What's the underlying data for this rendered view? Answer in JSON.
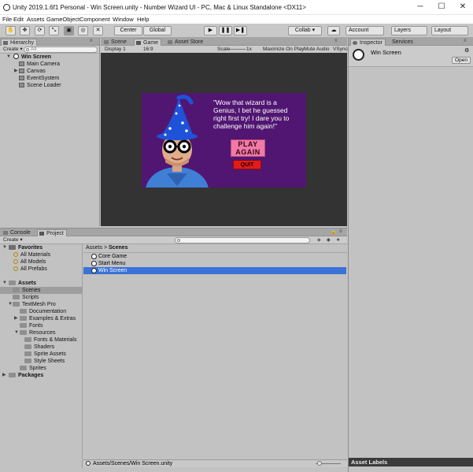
{
  "window": {
    "title": "Unity 2019.1.6f1 Personal - Win Screen.unity - Number Wizard UI - PC, Mac & Linux Standalone <DX11>",
    "minimize": "─",
    "maximize": "☐",
    "close": "✕"
  },
  "menu": [
    "File",
    "Edit",
    "Assets",
    "GameObject",
    "Component",
    "Window",
    "Help"
  ],
  "toolbar": {
    "tools": [
      "✋",
      "✥",
      "⟳",
      "⤡",
      "▣",
      "◎",
      "✕"
    ],
    "pivot_label": "Center",
    "space_label": "Global",
    "play": "▶",
    "pause": "❚❚",
    "step": "▶❚",
    "collab_label": "Collab ▾",
    "cloud": "☁",
    "account_label": "Account",
    "layers_label": "Layers",
    "layout_label": "Layout"
  },
  "hierarchy": {
    "tab_label": "Hierarchy",
    "create_label": "Create ▾",
    "search_placeholder": "All",
    "scene_name": "Win Screen",
    "items": [
      "Main Camera",
      "Canvas",
      "EventSystem",
      "Scene Loader"
    ]
  },
  "scene_tabs": {
    "scene": "Scene",
    "game": "Game",
    "asset_store": "Asset Store"
  },
  "game_bar": {
    "display": "Display 1",
    "aspect": "16:9",
    "scale_label": "Scale",
    "scale_value": "1x",
    "maximize": "Maximize On Play",
    "mute": "Mute Audio",
    "vsync": "VSync"
  },
  "game_view": {
    "dialog": "\"Wow that wizard is a Genius, I bet he guessed right first try! I dare you to challenge him again!\"",
    "play_button": "PLAY AGAIN",
    "quit_button": "QUIT"
  },
  "inspector": {
    "tab_label": "Inspector",
    "services_label": "Services",
    "object_name": "Win Screen",
    "open_label": "Open",
    "gear": "⚙"
  },
  "bottom_tabs": {
    "console": "Console",
    "project": "Project"
  },
  "project": {
    "create_label": "Create ▾",
    "search_placeholder": "",
    "favorites": {
      "label": "Favorites",
      "items": [
        "All Materials",
        "All Models",
        "All Prefabs"
      ]
    },
    "assets_label": "Assets",
    "packages_label": "Packages",
    "tree": [
      {
        "label": "Scenes",
        "depth": 1
      },
      {
        "label": "Scripts",
        "depth": 1
      },
      {
        "label": "TextMesh Pro",
        "depth": 1
      },
      {
        "label": "Documentation",
        "depth": 2
      },
      {
        "label": "Examples & Extras",
        "depth": 2
      },
      {
        "label": "Fonts",
        "depth": 2
      },
      {
        "label": "Resources",
        "depth": 2
      },
      {
        "label": "Fonts & Materials",
        "depth": 3
      },
      {
        "label": "Shaders",
        "depth": 3
      },
      {
        "label": "Sprite Assets",
        "depth": 3
      },
      {
        "label": "Style Sheets",
        "depth": 3
      },
      {
        "label": "Sprites",
        "depth": 2
      }
    ],
    "breadcrumb": [
      "Assets",
      "Scenes"
    ],
    "breadcrumb_sep": ">",
    "files": [
      "Core Game",
      "Start Menu",
      "Win Screen"
    ],
    "selected_path": "Assets/Scenes/Win Screen.unity"
  },
  "asset_labels": "Asset Labels",
  "colors": {
    "selection": "#3a72d9",
    "game_background": "#511672",
    "play_button": "#f07aa7",
    "quit_button": "#e31b1b"
  }
}
